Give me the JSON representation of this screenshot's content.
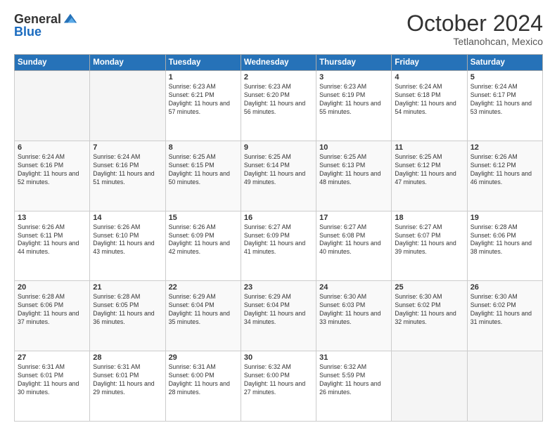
{
  "header": {
    "logo_general": "General",
    "logo_blue": "Blue",
    "title": "October 2024",
    "location": "Tetlanohcan, Mexico"
  },
  "weekdays": [
    "Sunday",
    "Monday",
    "Tuesday",
    "Wednesday",
    "Thursday",
    "Friday",
    "Saturday"
  ],
  "weeks": [
    [
      {
        "day": "",
        "info": ""
      },
      {
        "day": "",
        "info": ""
      },
      {
        "day": "1",
        "info": "Sunrise: 6:23 AM\nSunset: 6:21 PM\nDaylight: 11 hours and 57 minutes."
      },
      {
        "day": "2",
        "info": "Sunrise: 6:23 AM\nSunset: 6:20 PM\nDaylight: 11 hours and 56 minutes."
      },
      {
        "day": "3",
        "info": "Sunrise: 6:23 AM\nSunset: 6:19 PM\nDaylight: 11 hours and 55 minutes."
      },
      {
        "day": "4",
        "info": "Sunrise: 6:24 AM\nSunset: 6:18 PM\nDaylight: 11 hours and 54 minutes."
      },
      {
        "day": "5",
        "info": "Sunrise: 6:24 AM\nSunset: 6:17 PM\nDaylight: 11 hours and 53 minutes."
      }
    ],
    [
      {
        "day": "6",
        "info": "Sunrise: 6:24 AM\nSunset: 6:16 PM\nDaylight: 11 hours and 52 minutes."
      },
      {
        "day": "7",
        "info": "Sunrise: 6:24 AM\nSunset: 6:16 PM\nDaylight: 11 hours and 51 minutes."
      },
      {
        "day": "8",
        "info": "Sunrise: 6:25 AM\nSunset: 6:15 PM\nDaylight: 11 hours and 50 minutes."
      },
      {
        "day": "9",
        "info": "Sunrise: 6:25 AM\nSunset: 6:14 PM\nDaylight: 11 hours and 49 minutes."
      },
      {
        "day": "10",
        "info": "Sunrise: 6:25 AM\nSunset: 6:13 PM\nDaylight: 11 hours and 48 minutes."
      },
      {
        "day": "11",
        "info": "Sunrise: 6:25 AM\nSunset: 6:12 PM\nDaylight: 11 hours and 47 minutes."
      },
      {
        "day": "12",
        "info": "Sunrise: 6:26 AM\nSunset: 6:12 PM\nDaylight: 11 hours and 46 minutes."
      }
    ],
    [
      {
        "day": "13",
        "info": "Sunrise: 6:26 AM\nSunset: 6:11 PM\nDaylight: 11 hours and 44 minutes."
      },
      {
        "day": "14",
        "info": "Sunrise: 6:26 AM\nSunset: 6:10 PM\nDaylight: 11 hours and 43 minutes."
      },
      {
        "day": "15",
        "info": "Sunrise: 6:26 AM\nSunset: 6:09 PM\nDaylight: 11 hours and 42 minutes."
      },
      {
        "day": "16",
        "info": "Sunrise: 6:27 AM\nSunset: 6:09 PM\nDaylight: 11 hours and 41 minutes."
      },
      {
        "day": "17",
        "info": "Sunrise: 6:27 AM\nSunset: 6:08 PM\nDaylight: 11 hours and 40 minutes."
      },
      {
        "day": "18",
        "info": "Sunrise: 6:27 AM\nSunset: 6:07 PM\nDaylight: 11 hours and 39 minutes."
      },
      {
        "day": "19",
        "info": "Sunrise: 6:28 AM\nSunset: 6:06 PM\nDaylight: 11 hours and 38 minutes."
      }
    ],
    [
      {
        "day": "20",
        "info": "Sunrise: 6:28 AM\nSunset: 6:06 PM\nDaylight: 11 hours and 37 minutes."
      },
      {
        "day": "21",
        "info": "Sunrise: 6:28 AM\nSunset: 6:05 PM\nDaylight: 11 hours and 36 minutes."
      },
      {
        "day": "22",
        "info": "Sunrise: 6:29 AM\nSunset: 6:04 PM\nDaylight: 11 hours and 35 minutes."
      },
      {
        "day": "23",
        "info": "Sunrise: 6:29 AM\nSunset: 6:04 PM\nDaylight: 11 hours and 34 minutes."
      },
      {
        "day": "24",
        "info": "Sunrise: 6:30 AM\nSunset: 6:03 PM\nDaylight: 11 hours and 33 minutes."
      },
      {
        "day": "25",
        "info": "Sunrise: 6:30 AM\nSunset: 6:02 PM\nDaylight: 11 hours and 32 minutes."
      },
      {
        "day": "26",
        "info": "Sunrise: 6:30 AM\nSunset: 6:02 PM\nDaylight: 11 hours and 31 minutes."
      }
    ],
    [
      {
        "day": "27",
        "info": "Sunrise: 6:31 AM\nSunset: 6:01 PM\nDaylight: 11 hours and 30 minutes."
      },
      {
        "day": "28",
        "info": "Sunrise: 6:31 AM\nSunset: 6:01 PM\nDaylight: 11 hours and 29 minutes."
      },
      {
        "day": "29",
        "info": "Sunrise: 6:31 AM\nSunset: 6:00 PM\nDaylight: 11 hours and 28 minutes."
      },
      {
        "day": "30",
        "info": "Sunrise: 6:32 AM\nSunset: 6:00 PM\nDaylight: 11 hours and 27 minutes."
      },
      {
        "day": "31",
        "info": "Sunrise: 6:32 AM\nSunset: 5:59 PM\nDaylight: 11 hours and 26 minutes."
      },
      {
        "day": "",
        "info": ""
      },
      {
        "day": "",
        "info": ""
      }
    ]
  ]
}
